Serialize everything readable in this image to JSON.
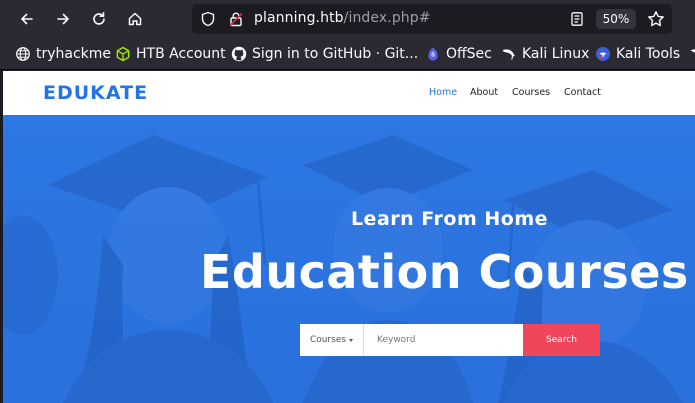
{
  "browser": {
    "url_host": "planning.htb",
    "url_path": "/index.php#",
    "zoom": "50%",
    "bookmarks": [
      {
        "label": "tryhackme",
        "icon": "globe-icon"
      },
      {
        "label": "HTB Account",
        "icon": "htb-cube-icon"
      },
      {
        "label": "Sign in to GitHub · Git...",
        "icon": "github-icon"
      },
      {
        "label": "OffSec",
        "icon": "offsec-icon"
      },
      {
        "label": "Kali Linux",
        "icon": "kali-dragon-icon"
      },
      {
        "label": "Kali Tools",
        "icon": "kali-tools-icon"
      }
    ]
  },
  "site": {
    "logo": "EDUKATE",
    "nav": [
      "Home",
      "About",
      "Courses",
      "Contact"
    ],
    "active_nav": "Home"
  },
  "hero": {
    "subtitle": "Learn From Home",
    "title": "Education Courses",
    "search": {
      "category": "Courses",
      "placeholder": "Keyword",
      "button": "Search"
    }
  },
  "colors": {
    "brand": "#2474e5",
    "hero_blue": "#2b74e0",
    "search_button": "#f0465b",
    "chrome_bg": "#2b2a33"
  }
}
